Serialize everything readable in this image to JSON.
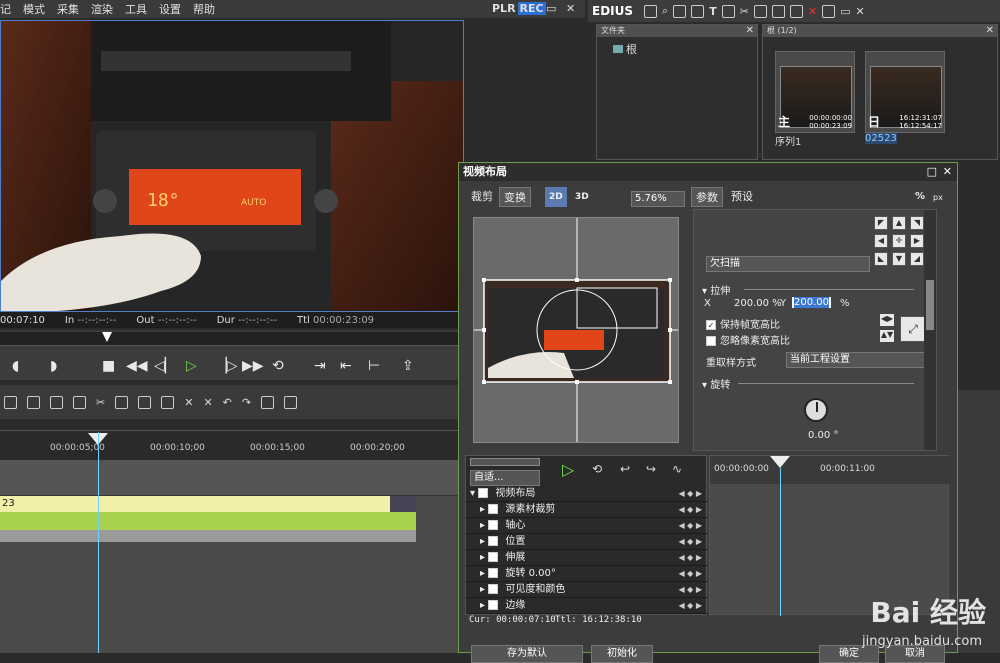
{
  "menu": [
    "记",
    "模式",
    "采集",
    "渲染",
    "工具",
    "设置",
    "帮助"
  ],
  "player": {
    "plr": "PLR",
    "rec": "REC"
  },
  "edius": {
    "logo": "EDIUS"
  },
  "folder_panel": {
    "title": "文件夹",
    "root": "根"
  },
  "bin_panel": {
    "title": "根 (1/2)",
    "clips": [
      {
        "name": "序列1",
        "tc_in": "00:00:00:00",
        "tc_out": "00:00:23:09",
        "channel": "主"
      },
      {
        "name": "02523",
        "tc_in": "16:12:31:07",
        "tc_out": "16:12:54:17",
        "channel": "日"
      }
    ]
  },
  "timecodes": {
    "cur": "00:07:10",
    "in_label": "In",
    "in": "--:--:--:--",
    "out_label": "Out",
    "out": "--:--:--:--",
    "dur_label": "Dur",
    "dur": "--:--:--:--",
    "ttl_label": "Ttl",
    "ttl": "00:00:23:09"
  },
  "timeline": {
    "ticks": [
      "00:00:05;00",
      "00:00:10;00",
      "00:00:15;00",
      "00:00:20;00"
    ],
    "clip_label": "23"
  },
  "dialog": {
    "title": "视频布局",
    "tabs": [
      "裁剪",
      "变换"
    ],
    "mode_2d": "2D",
    "mode_3d": "3D",
    "zoom": "5.76%",
    "right_tabs": [
      "参数",
      "预设"
    ],
    "unit_percent": "%",
    "unit_px": "px",
    "scan_mode": "欠扫描",
    "stretch_label": "拉伸",
    "stretch_x_label": "X",
    "stretch_x": "200.00 %",
    "stretch_y_label": "Y",
    "stretch_y": "200.00",
    "stretch_y_unit": "%",
    "keep_aspect": "保持帧宽高比",
    "ignore_pixel": "忽略像素宽高比",
    "resample_label": "重取样方式",
    "resample_value": "当前工程设置",
    "rotate_label": "旋转",
    "rotate_value": "0.00 °",
    "kf_mode": "自适...",
    "kf_rows": [
      {
        "label": "视频布局",
        "indent": 0
      },
      {
        "label": "源素材裁剪",
        "indent": 1
      },
      {
        "label": "轴心",
        "indent": 1
      },
      {
        "label": "位置",
        "indent": 1
      },
      {
        "label": "伸展",
        "indent": 1
      },
      {
        "label": "旋转  0.00°",
        "indent": 1
      },
      {
        "label": "可见度和颜色",
        "indent": 1
      },
      {
        "label": "边缘",
        "indent": 1
      }
    ],
    "kf_time_start": "00:00:00:00",
    "kf_time_mid": "00:00:11:00",
    "cur_label": "Cur: 00:00:07:10",
    "ttl_label": "Ttl: 16:12:38:10",
    "buttons": [
      "存为默认",
      "初始化",
      "确定",
      "取消"
    ]
  },
  "watermark": {
    "brand": "Bai 经验",
    "url": "jingyan.baidu.com"
  }
}
